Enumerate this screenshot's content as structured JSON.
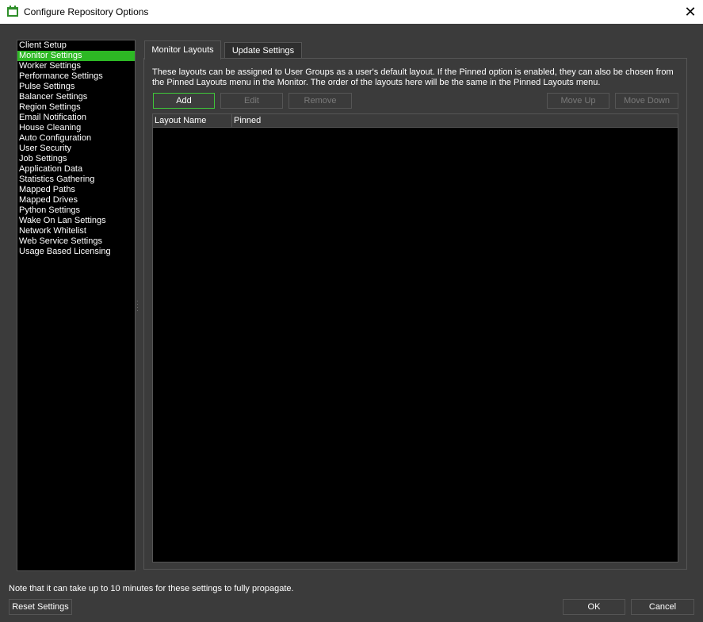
{
  "window": {
    "title": "Configure Repository Options",
    "close_glyph": "✕",
    "app_icon": "deadline-app-icon"
  },
  "sidebar": {
    "selected": 1,
    "items": [
      {
        "label": "Client Setup"
      },
      {
        "label": "Monitor Settings"
      },
      {
        "label": "Worker Settings"
      },
      {
        "label": "Performance Settings"
      },
      {
        "label": "Pulse Settings"
      },
      {
        "label": "Balancer Settings"
      },
      {
        "label": "Region Settings"
      },
      {
        "label": "Email Notification"
      },
      {
        "label": "House Cleaning"
      },
      {
        "label": "Auto Configuration"
      },
      {
        "label": "User Security"
      },
      {
        "label": "Job Settings"
      },
      {
        "label": "Application Data"
      },
      {
        "label": "Statistics Gathering"
      },
      {
        "label": "Mapped Paths"
      },
      {
        "label": "Mapped Drives"
      },
      {
        "label": "Python Settings"
      },
      {
        "label": "Wake On Lan Settings"
      },
      {
        "label": "Network Whitelist"
      },
      {
        "label": "Web Service Settings"
      },
      {
        "label": "Usage Based Licensing"
      }
    ]
  },
  "tabs": [
    {
      "label": "Monitor Layouts",
      "active": true
    },
    {
      "label": "Update Settings",
      "active": false
    }
  ],
  "monitor_layouts": {
    "description": "These layouts can be assigned to User Groups as a user's default layout. If the Pinned option is enabled, they can also be chosen from the Pinned Layouts menu in the Monitor. The order of the layouts here will be the same in the Pinned Layouts menu.",
    "buttons": {
      "add": "Add",
      "edit": "Edit",
      "remove": "Remove",
      "move_up": "Move Up",
      "move_down": "Move Down"
    },
    "columns": [
      "Layout Name",
      "Pinned"
    ],
    "rows": []
  },
  "footer": {
    "note": "Note that it can take up to 10 minutes for these settings to fully propagate.",
    "reset": "Reset Settings",
    "ok": "OK",
    "cancel": "Cancel"
  },
  "colors": {
    "accent": "#2db824",
    "background": "#3b3b3b",
    "list_background": "#000000"
  }
}
